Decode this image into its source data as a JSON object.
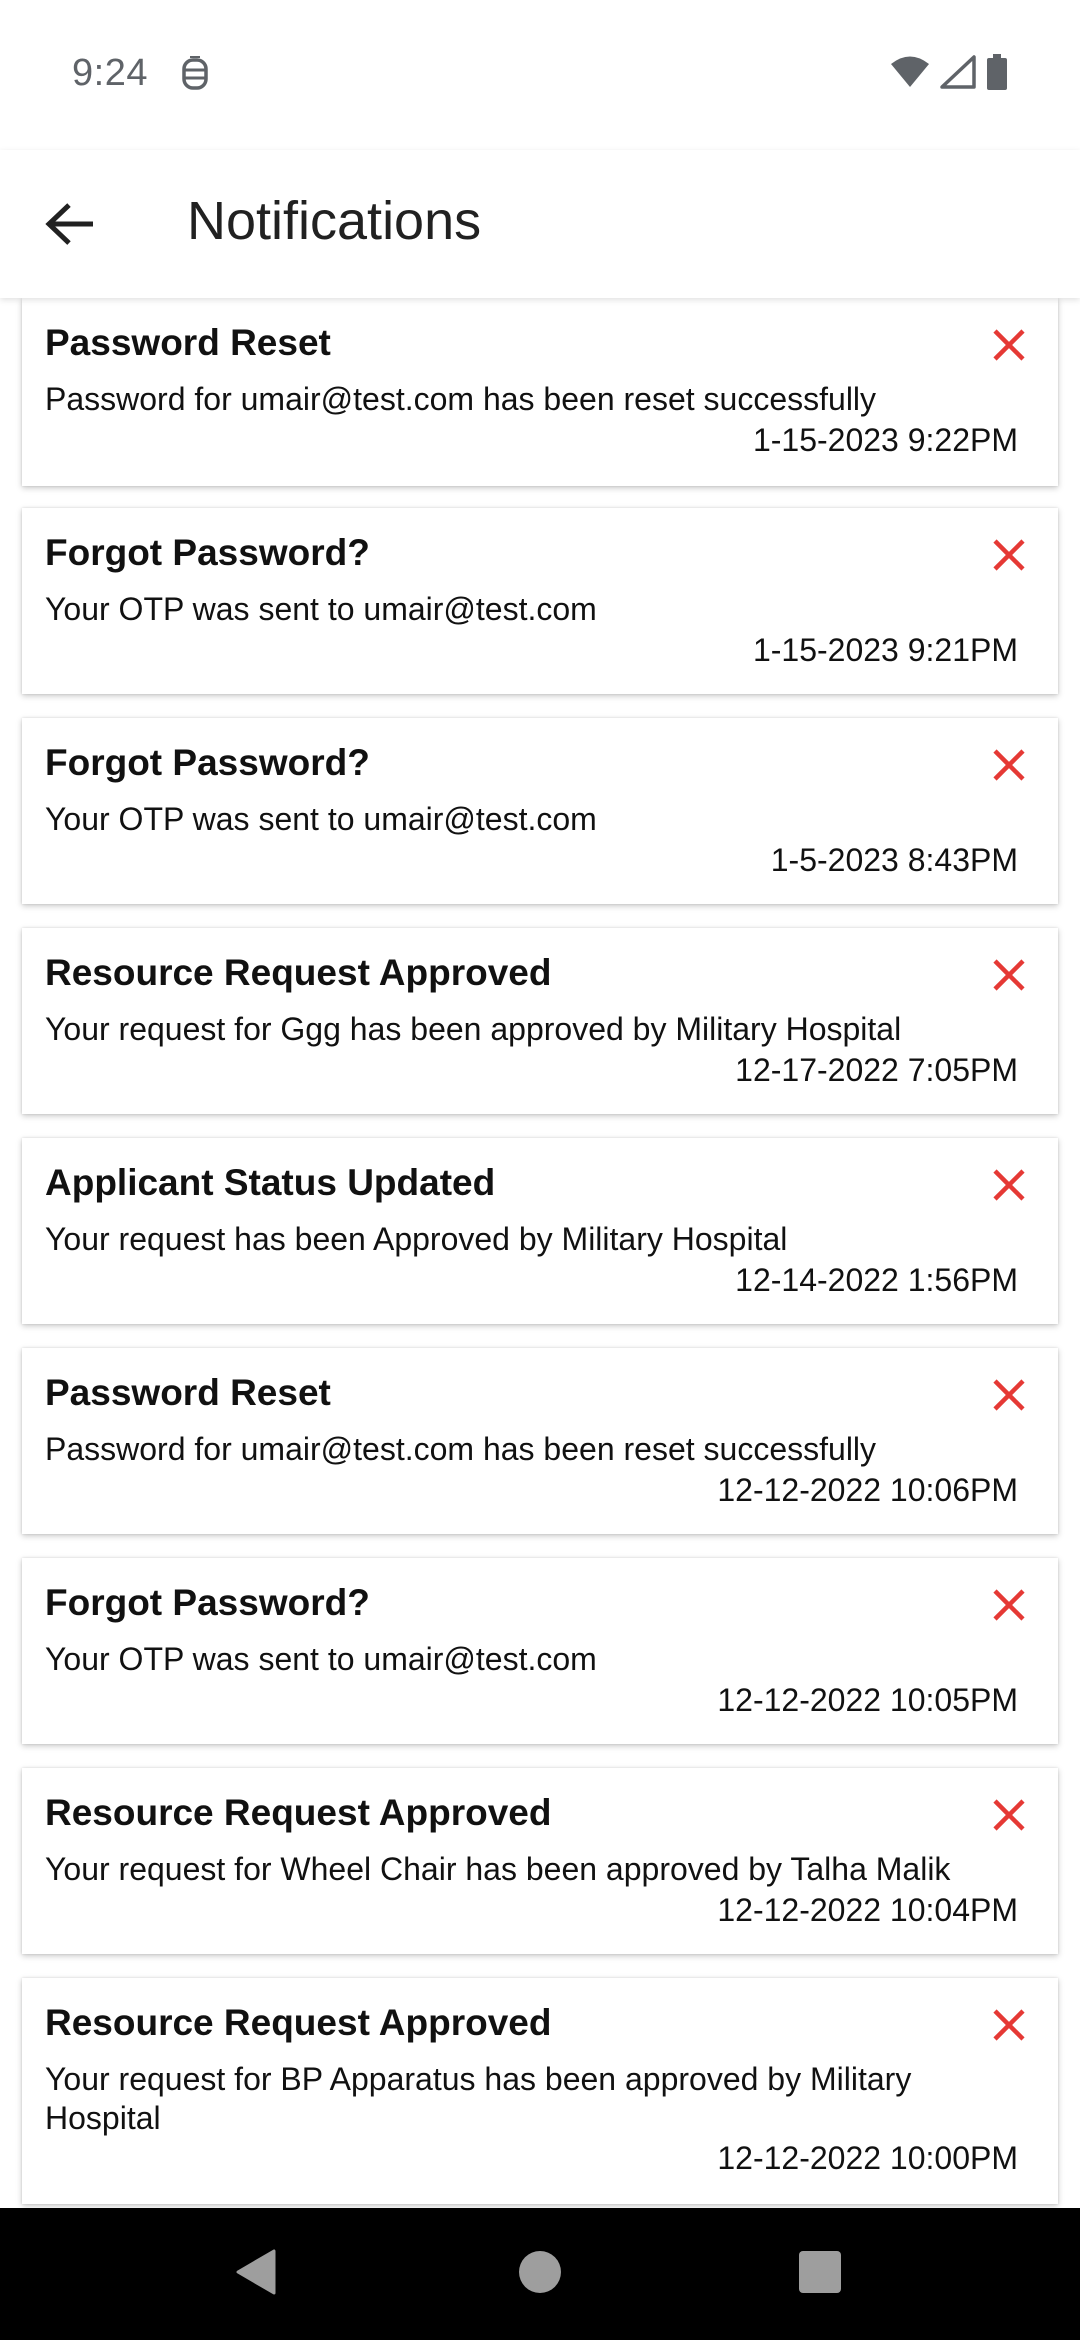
{
  "status_bar": {
    "time": "9:24",
    "icons": [
      "notification-icon",
      "wifi-icon",
      "signal-icon",
      "battery-icon"
    ]
  },
  "app_bar": {
    "title": "Notifications",
    "back_icon": "arrow-back-icon"
  },
  "colors": {
    "close_icon": "#e53935",
    "nav_bar": "#000000",
    "nav_icon": "#9e9e9e"
  },
  "notifications": [
    {
      "title": "Password Reset",
      "body": "Password for umair@test.com has been reset successfully",
      "time": "1-15-2023 9:22PM"
    },
    {
      "title": "Forgot Password?",
      "body": "Your OTP was sent to umair@test.com",
      "time": "1-15-2023 9:21PM"
    },
    {
      "title": "Forgot Password?",
      "body": "Your OTP was sent to umair@test.com",
      "time": "1-5-2023 8:43PM"
    },
    {
      "title": "Resource Request Approved",
      "body": "Your request for Ggg has been approved by Military Hospital",
      "time": "12-17-2022 7:05PM"
    },
    {
      "title": "Applicant Status Updated",
      "body": "Your request has been Approved by Military Hospital",
      "time": "12-14-2022 1:56PM"
    },
    {
      "title": "Password Reset",
      "body": "Password for umair@test.com has been reset successfully",
      "time": "12-12-2022 10:06PM"
    },
    {
      "title": "Forgot Password?",
      "body": "Your OTP was sent to umair@test.com",
      "time": "12-12-2022 10:05PM"
    },
    {
      "title": "Resource Request Approved",
      "body": "Your request for Wheel Chair has been approved by Talha Malik",
      "time": "12-12-2022 10:04PM"
    },
    {
      "title": "Resource Request Approved",
      "body": "Your request for BP Apparatus has been approved by Military Hospital",
      "time": "12-12-2022 10:00PM"
    }
  ],
  "nav_bar": {
    "icons": [
      "nav-back-icon",
      "nav-home-icon",
      "nav-recents-icon"
    ]
  }
}
